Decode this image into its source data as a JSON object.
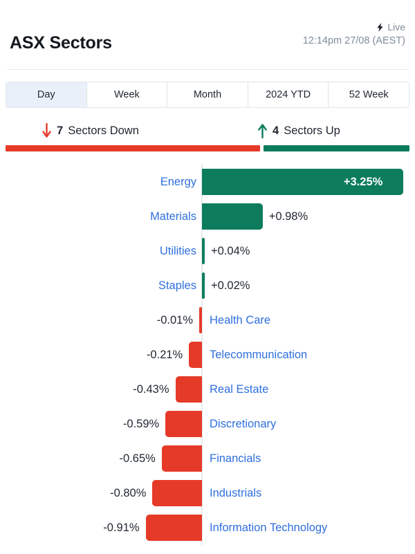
{
  "header": {
    "title": "ASX Sectors",
    "live_label": "Live",
    "live_icon": "bolt-icon",
    "timestamp": "12:14pm 27/08 (AEST)"
  },
  "tabs": {
    "items": [
      {
        "label": "Day",
        "active": true
      },
      {
        "label": "Week",
        "active": false
      },
      {
        "label": "Month",
        "active": false
      },
      {
        "label": "2024 YTD",
        "active": false
      },
      {
        "label": "52 Week",
        "active": false
      }
    ]
  },
  "summary": {
    "down": {
      "count": "7",
      "label": "Sectors Down",
      "icon": "arrow-down-icon"
    },
    "up": {
      "count": "4",
      "label": "Sectors Up",
      "icon": "arrow-up-icon"
    },
    "split_down_fraction": 0.636,
    "split_up_fraction": 0.364
  },
  "colors": {
    "positive": "#0C7C5D",
    "negative": "#E63A28",
    "sector_label": "#2E6FDE",
    "value_text": "#1f2630",
    "axis": "#e6e9ed",
    "tab_active_bg": "#e9f0f9",
    "muted_text": "#7f8c9b"
  },
  "chart_data": {
    "type": "bar",
    "orientation": "horizontal",
    "title": "ASX Sectors",
    "xlabel": "",
    "ylabel": "",
    "unit": "%",
    "zero_axis": true,
    "grid": false,
    "legend": "none",
    "xlim": [
      -0.91,
      3.25
    ],
    "categories": [
      "Energy",
      "Materials",
      "Utilities",
      "Staples",
      "Health Care",
      "Telecommunication",
      "Real Estate",
      "Discretionary",
      "Financials",
      "Industrials",
      "Information Technology"
    ],
    "values": [
      3.25,
      0.98,
      0.04,
      0.02,
      -0.01,
      -0.21,
      -0.43,
      -0.59,
      -0.65,
      -0.8,
      -0.91
    ],
    "value_labels": [
      "+3.25%",
      "+0.98%",
      "+0.04%",
      "+0.02%",
      "-0.01%",
      "-0.21%",
      "-0.43%",
      "-0.59%",
      "-0.65%",
      "-0.80%",
      "-0.91%"
    ],
    "rows": [
      {
        "name": "Energy",
        "value": 3.25,
        "label": "+3.25%",
        "direction": "up",
        "label_inside": true
      },
      {
        "name": "Materials",
        "value": 0.98,
        "label": "+0.98%",
        "direction": "up",
        "label_inside": false
      },
      {
        "name": "Utilities",
        "value": 0.04,
        "label": "+0.04%",
        "direction": "up",
        "label_inside": false
      },
      {
        "name": "Staples",
        "value": 0.02,
        "label": "+0.02%",
        "direction": "up",
        "label_inside": false
      },
      {
        "name": "Health Care",
        "value": -0.01,
        "label": "-0.01%",
        "direction": "down",
        "label_inside": false
      },
      {
        "name": "Telecommunication",
        "value": -0.21,
        "label": "-0.21%",
        "direction": "down",
        "label_inside": false
      },
      {
        "name": "Real Estate",
        "value": -0.43,
        "label": "-0.43%",
        "direction": "down",
        "label_inside": false
      },
      {
        "name": "Discretionary",
        "value": -0.59,
        "label": "-0.59%",
        "direction": "down",
        "label_inside": false
      },
      {
        "name": "Financials",
        "value": -0.65,
        "label": "-0.65%",
        "direction": "down",
        "label_inside": false
      },
      {
        "name": "Industrials",
        "value": -0.8,
        "label": "-0.80%",
        "direction": "down",
        "label_inside": false
      },
      {
        "name": "Information Technology",
        "value": -0.91,
        "label": "-0.91%",
        "direction": "down",
        "label_inside": false
      }
    ]
  }
}
